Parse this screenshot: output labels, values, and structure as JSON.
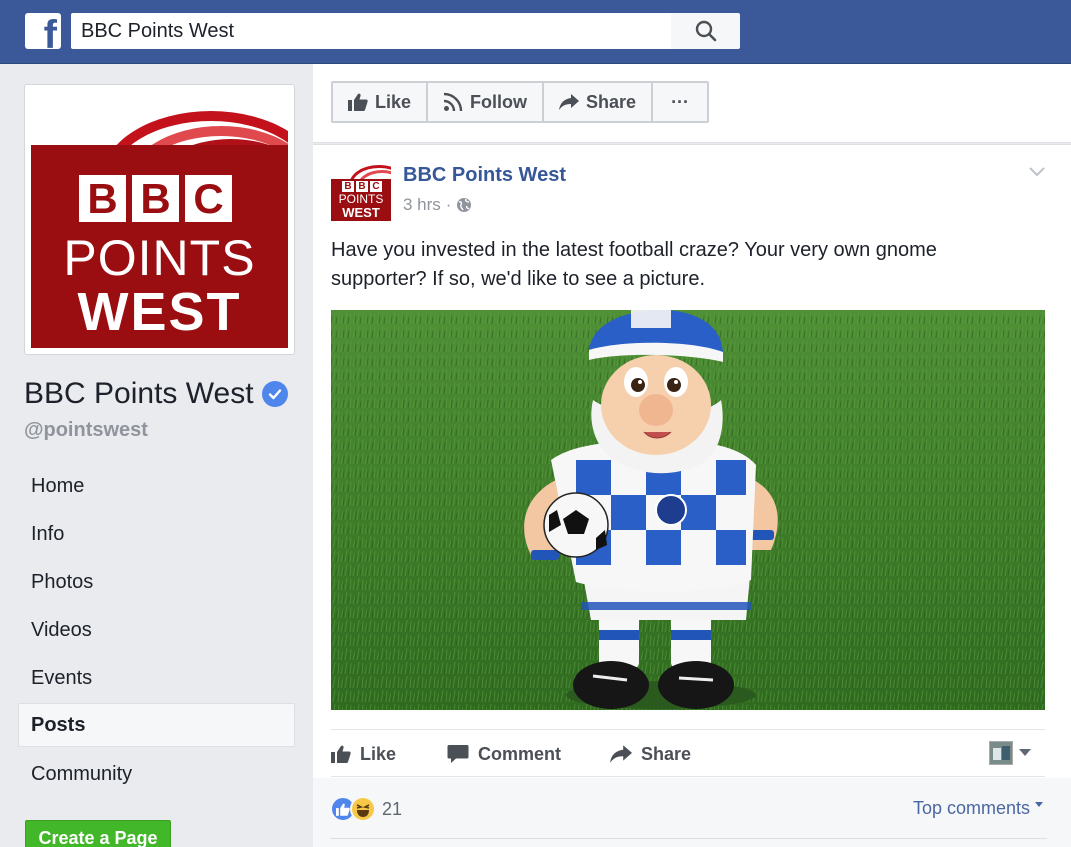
{
  "topbar": {
    "logo_letter": "f",
    "search_value": "BBC Points West"
  },
  "page": {
    "name": "BBC Points West",
    "handle": "@pointswest",
    "logo": {
      "bbc_letters": [
        "B",
        "B",
        "C"
      ],
      "line1": "POINTS",
      "line2": "WEST"
    }
  },
  "nav": {
    "items": [
      {
        "label": "Home"
      },
      {
        "label": "Info"
      },
      {
        "label": "Photos"
      },
      {
        "label": "Videos"
      },
      {
        "label": "Events"
      },
      {
        "label": "Posts"
      },
      {
        "label": "Community"
      }
    ],
    "active": "Posts"
  },
  "create_page_label": "Create a Page",
  "action_bar": {
    "like": "Like",
    "follow": "Follow",
    "share": "Share",
    "more": "···"
  },
  "post": {
    "author": "BBC Points West",
    "time": "3 hrs",
    "separator": "·",
    "text": "Have you invested in the latest football craze? Your very own gnome supporter? If so, we'd like to see a picture.",
    "actions": {
      "like": "Like",
      "comment": "Comment",
      "share": "Share"
    },
    "reactions_count": "21",
    "top_comments": "Top comments"
  },
  "colors": {
    "facebook_blue": "#3b5998",
    "link_blue": "#365899",
    "bbc_red": "#9a0e12",
    "create_green": "#42b72a",
    "grass_green": "#3d7a2a"
  }
}
